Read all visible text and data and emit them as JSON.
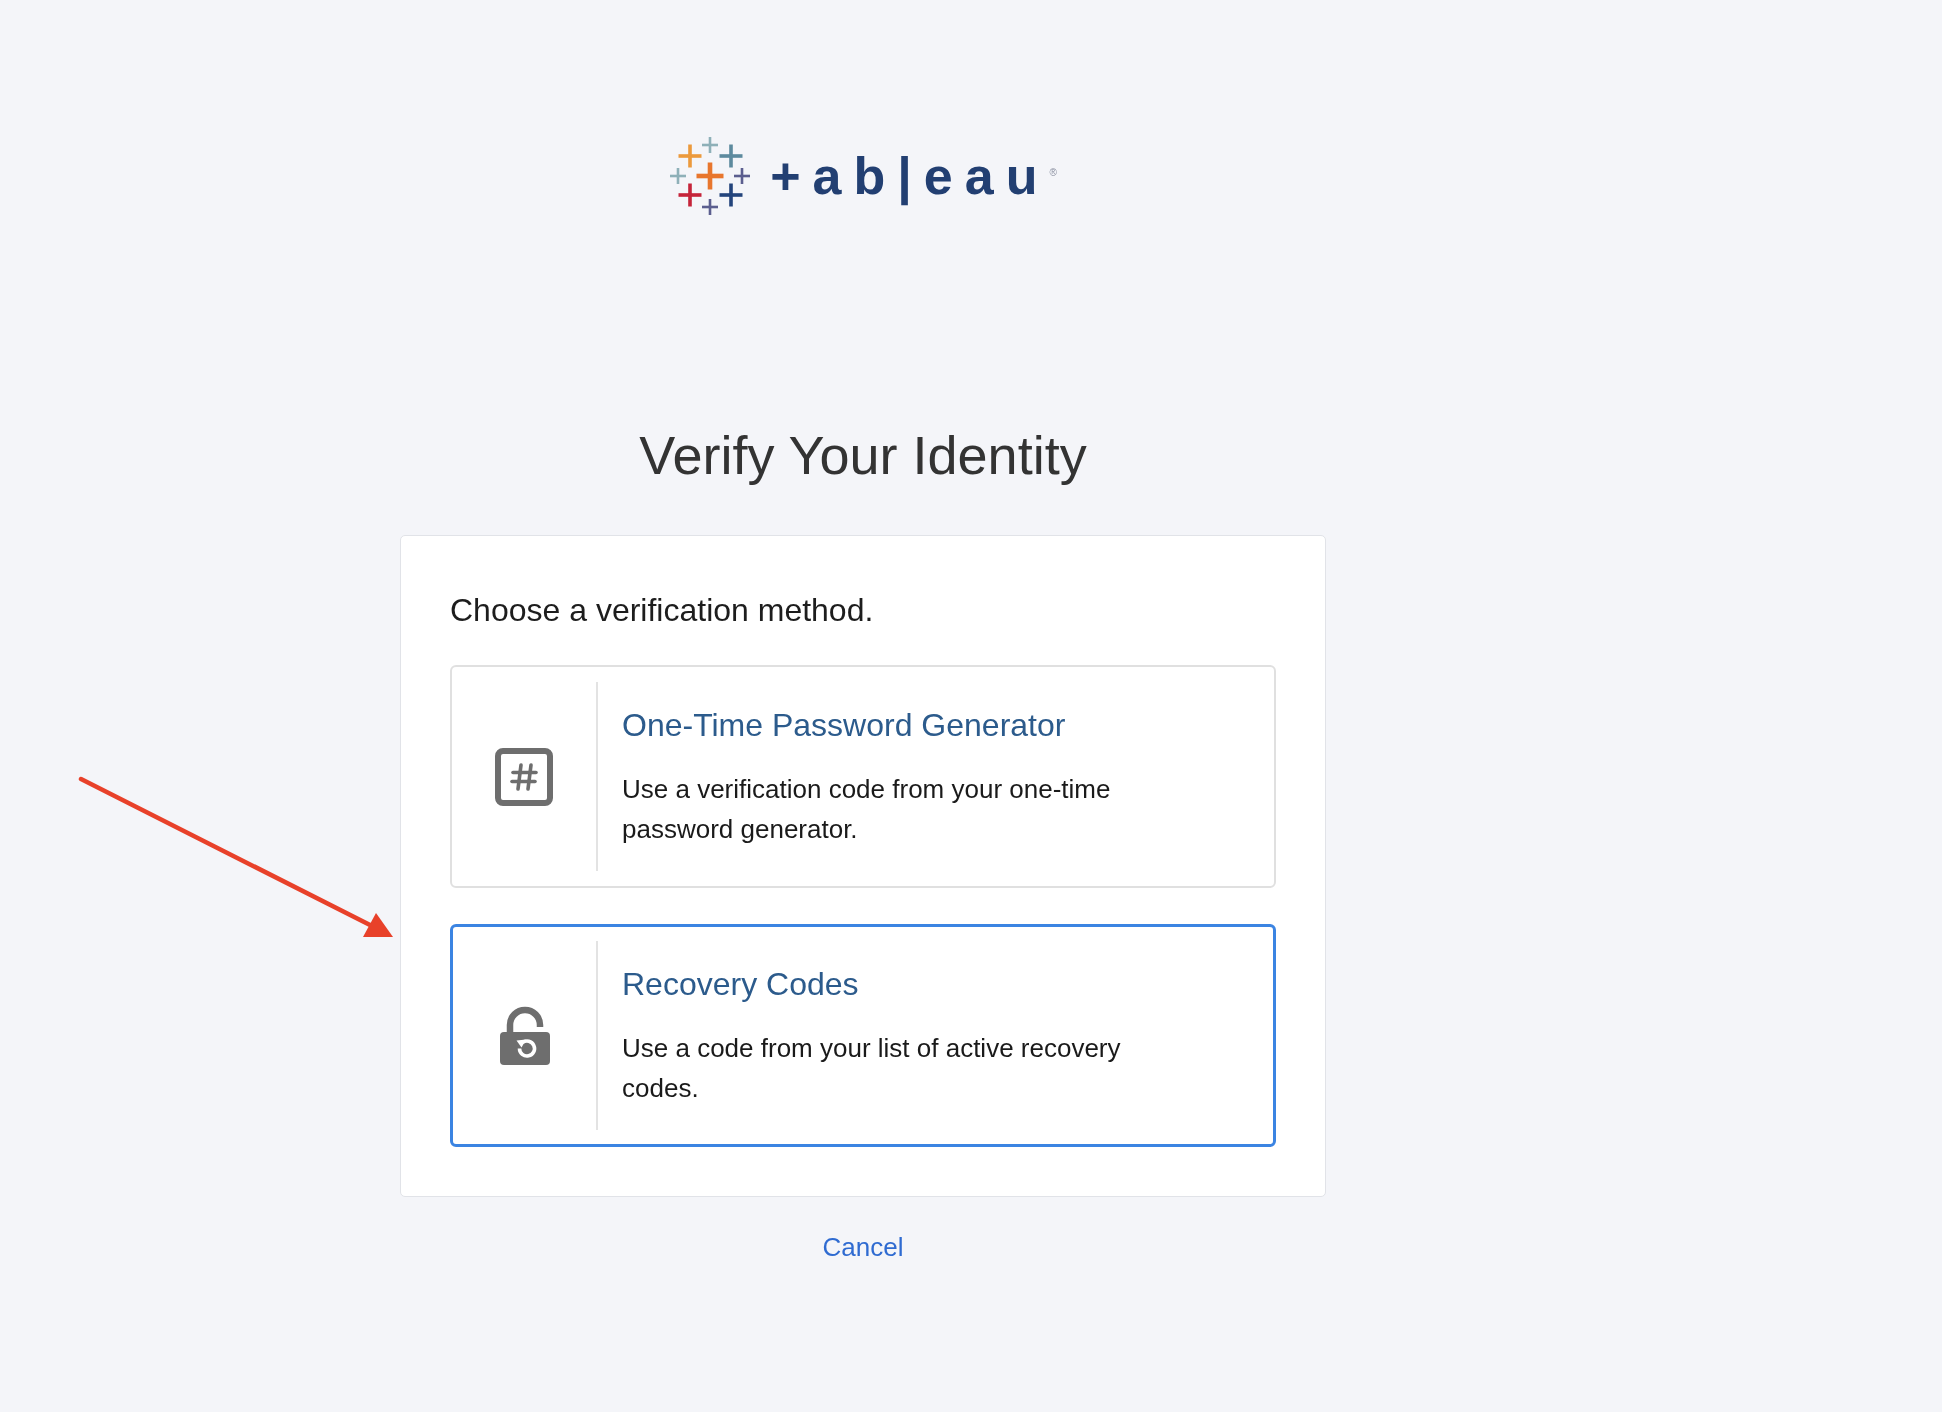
{
  "logo": {
    "wordmark": "+ab|eau",
    "registered_mark": "®"
  },
  "title": "Verify Your Identity",
  "card": {
    "prompt": "Choose a verification method.",
    "methods": [
      {
        "kind": "otp",
        "title": "One-Time Password Generator",
        "description": "Use a verification code from your one-time password generator.",
        "selected": false
      },
      {
        "kind": "recovery",
        "title": "Recovery Codes",
        "description": "Use a code from your list of active recovery codes.",
        "selected": true
      }
    ]
  },
  "cancel": "Cancel"
}
